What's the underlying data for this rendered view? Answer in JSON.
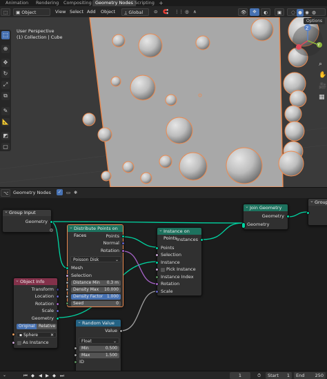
{
  "topbar": {
    "tabs": [
      "Animation",
      "Rendering",
      "Compositing",
      "Geometry Nodes",
      "Scripting"
    ],
    "active_tab": "Geometry Nodes",
    "add_tab": "+"
  },
  "viewport_header": {
    "mode": "Object Mode",
    "menus": [
      "View",
      "Select",
      "Add",
      "Object"
    ],
    "transform_orientation": "Global",
    "options_label": "Options"
  },
  "viewport": {
    "perspective_label": "User Perspective",
    "collection_label": "(1) Collection | Cube",
    "gizmo_labels": {
      "y": "Y",
      "z": "Z"
    }
  },
  "node_editor_header": {
    "editor_name": "Geometry Nodes"
  },
  "nodes": {
    "group_input": {
      "title": "Group Input",
      "geometry": "Geometry"
    },
    "distribute": {
      "title": "Distribute Points on Faces",
      "out_points": "Points",
      "out_normal": "Normal",
      "out_rotation": "Rotation",
      "method": "Poisson Disk",
      "mesh": "Mesh",
      "selection": "Selection",
      "distance_min_label": "Distance Min",
      "distance_min_value": "0.3 m",
      "density_max_label": "Density Max",
      "density_max_value": "10.000",
      "density_factor_label": "Density Factor",
      "density_factor_value": "1.000",
      "seed_label": "Seed",
      "seed_value": "0"
    },
    "instance": {
      "title": "Instance on Points",
      "out_instances": "Instances",
      "points": "Points",
      "selection": "Selection",
      "instance": "Instance",
      "pick_instance": "Pick Instance",
      "instance_index": "Instance Index",
      "rotation": "Rotation",
      "scale": "Scale"
    },
    "join": {
      "title": "Join Geometry",
      "out_geometry": "Geometry",
      "in_geometry": "Geometry"
    },
    "group_output": {
      "title": "Group"
    },
    "object_info": {
      "title": "Object Info",
      "transform": "Transform",
      "location": "Location",
      "rotation": "Rotation",
      "scale": "Scale",
      "geometry": "Geometry",
      "original": "Original",
      "relative": "Relative",
      "object": "Sphere",
      "as_instance": "As Instance"
    },
    "random_value": {
      "title": "Random Value",
      "out_value": "Value",
      "type": "Float",
      "min_label": "Min",
      "min_value": "0.500",
      "max_label": "Max",
      "max_value": "1.500",
      "id": "ID"
    }
  },
  "timeline": {
    "current_frame": "1",
    "start_label": "Start",
    "start_value": "1",
    "end_label": "End",
    "end_value": "250"
  },
  "colors": {
    "accent_blue": "#4772b3",
    "selection_orange": "#ed8a4f",
    "geometry_socket": "#00d6a3",
    "node_header_green": "#1d725e",
    "node_header_red": "#83314a",
    "node_header_blue": "#246283"
  }
}
